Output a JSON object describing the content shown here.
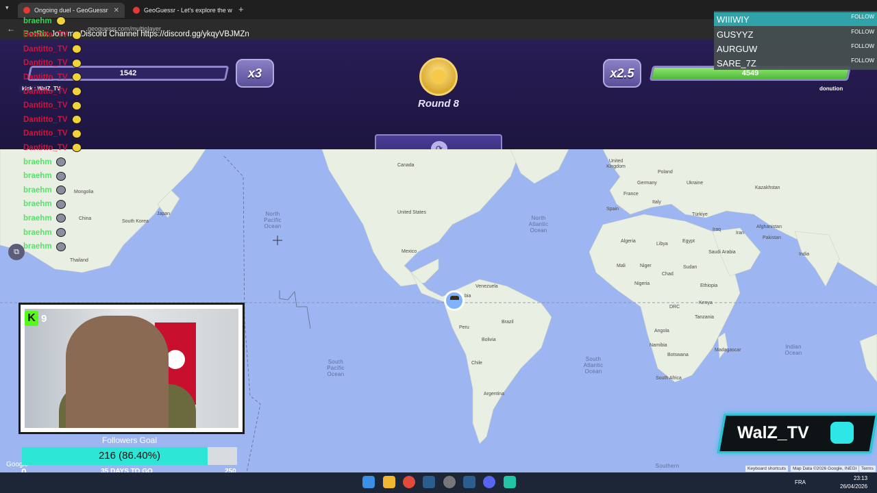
{
  "browser": {
    "tabs": [
      {
        "label": "Ongoing duel - GeoGuessr"
      },
      {
        "label": "GeoGuessr - Let's explore the w"
      }
    ],
    "url": "geoguessr.com/multiplayer"
  },
  "game": {
    "left_player": {
      "health": 1542,
      "health_fraction": 0.0
    },
    "left_multiplier": "x3",
    "right_player": {
      "health": 4549,
      "health_fraction": 1.0,
      "name": "donution"
    },
    "right_multiplier": "x2.5",
    "round_label": "Round 8"
  },
  "chat": {
    "bot_message_user": "BotRix",
    "bot_message_text": "Join my Discord Channel https://discord.gg/ykqyVBJMZn",
    "mod_line": "kick : WalZ_TV",
    "lines": [
      {
        "user": "braehm",
        "color": "#39d353"
      },
      {
        "user": "Dantitto_TV",
        "color": "#d0143a"
      },
      {
        "user": "Dantitto_TV",
        "color": "#d0143a"
      },
      {
        "user": "Dantitto_TV",
        "color": "#d0143a"
      },
      {
        "user": "Dantitto_TV",
        "color": "#d0143a"
      },
      {
        "user": "Dantitto_TV",
        "color": "#d0143a"
      },
      {
        "user": "Dantitto_TV",
        "color": "#d0143a"
      },
      {
        "user": "Dantitto_TV",
        "color": "#d0143a"
      },
      {
        "user": "Dantitto_TV",
        "color": "#d0143a"
      },
      {
        "user": "Dantitto_TV",
        "color": "#d0143a"
      },
      {
        "user": "braehm",
        "color": "#55e26b"
      },
      {
        "user": "braehm",
        "color": "#55e26b"
      },
      {
        "user": "braehm",
        "color": "#55e26b"
      },
      {
        "user": "braehm",
        "color": "#55e26b"
      },
      {
        "user": "braehm",
        "color": "#55e26b"
      },
      {
        "user": "braehm",
        "color": "#55e26b"
      },
      {
        "user": "braehm",
        "color": "#55e26b"
      }
    ]
  },
  "map": {
    "oceans": {
      "north_pacific": "North Pacific Ocean",
      "north_atlantic": "North Atlantic Ocean",
      "south_pacific": "South Pacific Ocean",
      "south_atlantic": "South Atlantic Ocean",
      "indian": "Indian Ocean",
      "southern": "Southern"
    },
    "countries": {
      "canada": "Canada",
      "united_states": "United States",
      "mexico": "Mexico",
      "venezuela": "Venezuela",
      "colombia": "bia",
      "brazil": "Brazil",
      "peru": "Peru",
      "bolivia": "Bolivia",
      "chile": "Chile",
      "argentina": "Argentina",
      "mongolia": "Mongolia",
      "china": "China",
      "south_korea": "South Korea",
      "japan": "Japan",
      "thailand": "Thailand",
      "united_kingdom": "United Kingdom",
      "germany": "Germany",
      "poland": "Poland",
      "ukraine": "Ukraine",
      "france": "France",
      "spain": "Spain",
      "italy": "Italy",
      "turkiye": "Türkiye",
      "kazakhstan": "Kazakhstan",
      "iraq": "Iraq",
      "iran": "Iran",
      "afghanistan": "Afghanistan",
      "pakistan": "Pakistan",
      "india": "India",
      "saudi_arabia": "Saudi Arabia",
      "algeria": "Algeria",
      "libya": "Libya",
      "egypt": "Egypt",
      "mali": "Mali",
      "niger": "Niger",
      "chad": "Chad",
      "sudan": "Sudan",
      "nigeria": "Nigeria",
      "ethiopia": "Ethiopia",
      "kenya": "Kenya",
      "drc": "DRC",
      "tanzania": "Tanzania",
      "angola": "Angola",
      "namibia": "Namibia",
      "botswana": "Botswana",
      "madagascar": "Madagascar",
      "south_africa": "South Africa"
    },
    "attribution": {
      "google": "Google",
      "keyboard": "Keyboard shortcuts",
      "map_data": "Map Data ©2026 Google, INEGI",
      "terms": "Terms"
    }
  },
  "webcam": {
    "kick_count": "9",
    "kick_letter": "K"
  },
  "followers_goal": {
    "title": "Followers Goal",
    "progress_text": "216 (86.40%)",
    "progress_fraction": 0.864,
    "min": "0",
    "max": "250",
    "days_left": "35 DAYS TO GO"
  },
  "follow_list": [
    {
      "name": "WIIIWIY",
      "label": "FOLLOW"
    },
    {
      "name": "GUSYYZ",
      "label": "FOLLOW"
    },
    {
      "name": "AURGUW",
      "label": "FOLLOW"
    },
    {
      "name": "SARE_7Z",
      "label": "FOLLOW"
    }
  ],
  "banner": {
    "name": "WalZ_TV"
  },
  "taskbar": {
    "language": "FRA",
    "time": "23:13",
    "date": "26/04/2026"
  },
  "colors": {
    "header_bg": "#281d55",
    "map_ocean": "#9db6f2",
    "land": "#e9efe2",
    "health_green": "#6fd34e",
    "goal_fill": "#2ee6d6",
    "banner_accent": "#24c8d8"
  }
}
